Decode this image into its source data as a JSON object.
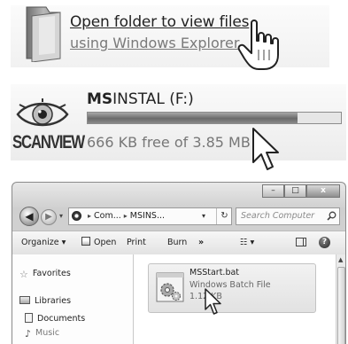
{
  "autoplay_option": {
    "line1": "Open folder to view files",
    "line2": "using Windows Explorer",
    "folder_icon": "folder-icon",
    "cursor": "hand-pointer-cursor"
  },
  "drive": {
    "logo_text": "SCANVIEW",
    "name_bold": "MS",
    "name_rest": "INSTAL (F:)",
    "free_text": "666 KB free of 3.85 MB",
    "used_fraction": 0.83,
    "cursor": "arrow-cursor"
  },
  "explorer": {
    "window_controls": [
      "–",
      "□",
      "x"
    ],
    "nav": {
      "back": "◀",
      "forward": "▶",
      "dropdown": "▾"
    },
    "address": {
      "crumb1": "Com...",
      "crumb2": "MSINS...",
      "separator": "▸",
      "dropdown": "▾",
      "refresh": "↻"
    },
    "search_placeholder": "Search Computer",
    "toolbar": {
      "organize": "Organize ▾",
      "open": "Open",
      "print": "Print",
      "burn": "Burn",
      "more": "»",
      "views": "☷ ▾",
      "help": "?"
    },
    "nav_pane": {
      "favorites": "Favorites",
      "libraries": "Libraries",
      "documents": "Documents",
      "music": "Music",
      "star_glyph": "☆",
      "music_glyph": "♪"
    },
    "file": {
      "name": "MSStart.bat",
      "type": "Windows Batch File",
      "size": "1.12 KB",
      "icon": "gears-batch-file-icon"
    },
    "scrollbar": {
      "up": "▲",
      "grip": "≡"
    }
  }
}
